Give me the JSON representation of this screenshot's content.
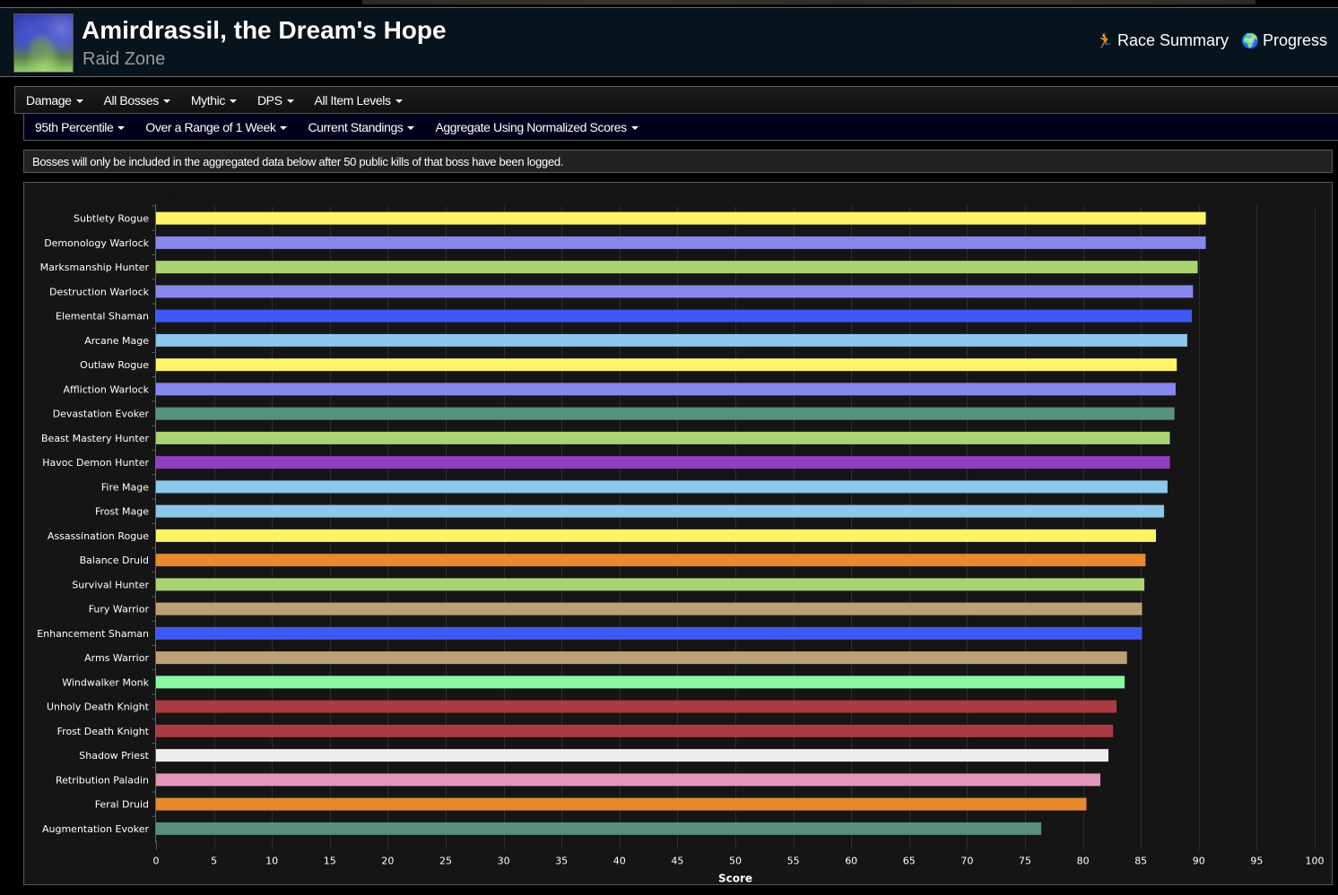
{
  "header": {
    "title": "Amirdrassil, the Dream's Hope",
    "subtitle": "Raid Zone",
    "zone_icon": "amirdrassil-zone-icon",
    "links": [
      {
        "label": "Race Summary",
        "icon": "running-person-icon",
        "glyph": "🏃"
      },
      {
        "label": "Progress",
        "icon": "globe-icon",
        "glyph": "🌍"
      }
    ]
  },
  "filters": {
    "row1": [
      {
        "label": "Damage"
      },
      {
        "label": "All Bosses"
      },
      {
        "label": "Mythic"
      },
      {
        "label": "DPS"
      },
      {
        "label": "All Item Levels"
      }
    ],
    "row2": [
      {
        "label": "95th Percentile"
      },
      {
        "label": "Over a Range of 1 Week"
      },
      {
        "label": "Current Standings"
      },
      {
        "label": "Aggregate Using Normalized Scores"
      }
    ]
  },
  "notice": "Bosses will only be included in the aggregated data below after 50 public kills of that boss have been logged.",
  "chart_data": {
    "type": "bar",
    "orientation": "horizontal",
    "title": "",
    "zoom_label": "Zoom",
    "xlabel": "Score",
    "ylabel": "",
    "xlim": [
      0,
      100
    ],
    "xticks": [
      0,
      5,
      10,
      15,
      20,
      25,
      30,
      35,
      40,
      45,
      50,
      55,
      60,
      65,
      70,
      75,
      80,
      85,
      90,
      95,
      100
    ],
    "grid": true,
    "legend": "none",
    "categories": [
      "Subtlety Rogue",
      "Demonology Warlock",
      "Marksmanship Hunter",
      "Destruction Warlock",
      "Elemental Shaman",
      "Arcane Mage",
      "Outlaw Rogue",
      "Affliction Warlock",
      "Devastation Evoker",
      "Beast Mastery Hunter",
      "Havoc Demon Hunter",
      "Fire Mage",
      "Frost Mage",
      "Assassination Rogue",
      "Balance Druid",
      "Survival Hunter",
      "Fury Warrior",
      "Enhancement Shaman",
      "Arms Warrior",
      "Windwalker Monk",
      "Unholy Death Knight",
      "Frost Death Knight",
      "Shadow Priest",
      "Retribution Paladin",
      "Feral Druid",
      "Augmentation Evoker"
    ],
    "values": [
      90.6,
      90.6,
      89.9,
      89.5,
      89.4,
      89.0,
      88.1,
      88.0,
      87.9,
      87.5,
      87.5,
      87.3,
      87.0,
      86.3,
      85.4,
      85.3,
      85.1,
      85.1,
      83.8,
      83.6,
      82.9,
      82.6,
      82.2,
      81.5,
      80.3,
      76.4
    ],
    "colors": [
      "#fff468",
      "#8788ee",
      "#aad372",
      "#8788ee",
      "#3f58f5",
      "#8cc7ec",
      "#fff468",
      "#8788ee",
      "#58907f",
      "#aad372",
      "#8f40c1",
      "#8cc7ec",
      "#8cc7ec",
      "#fff468",
      "#e6892f",
      "#aad372",
      "#bca176",
      "#3f58f5",
      "#bca176",
      "#88f9a0",
      "#ab3b42",
      "#ab3b42",
      "#eeeeee",
      "#e196ba",
      "#e6892f",
      "#58907f"
    ]
  }
}
